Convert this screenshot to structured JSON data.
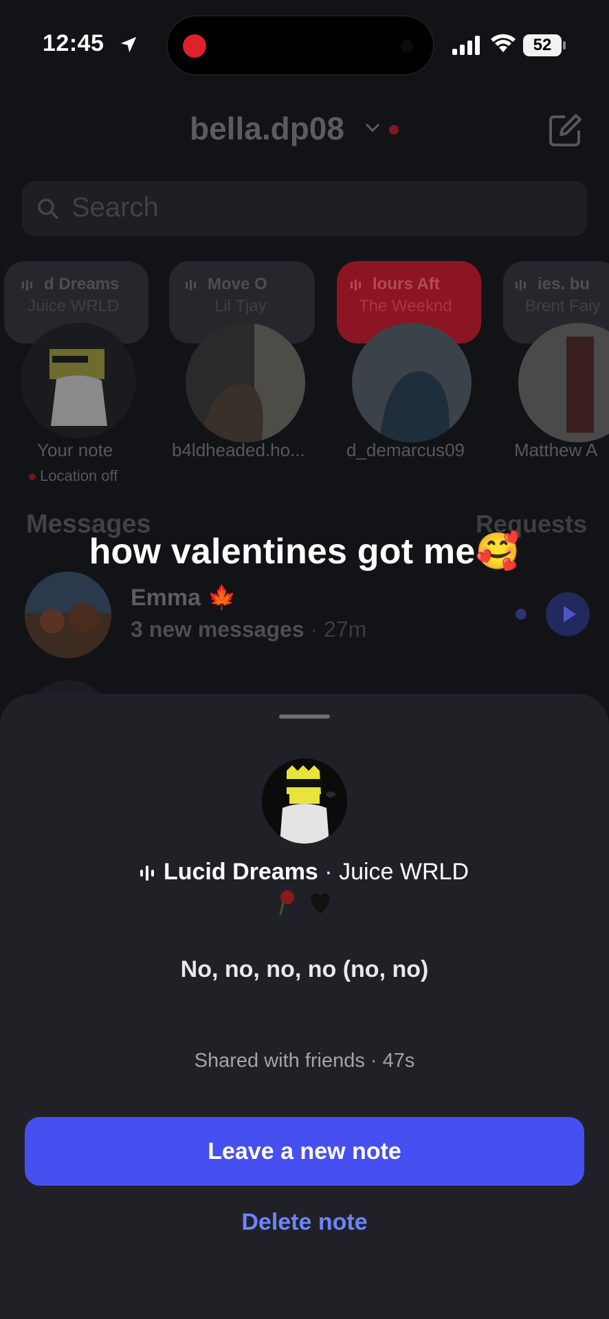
{
  "status_bar": {
    "time": "12:45",
    "battery": "52"
  },
  "header": {
    "account": "bella.dp08"
  },
  "search": {
    "placeholder": "Search"
  },
  "notes": [
    {
      "line1": "d Dreams",
      "line2": "Juice WRLD",
      "name": "Your note",
      "sub": "Location off"
    },
    {
      "line1": "Move O",
      "line2": "Lil Tjay",
      "name": "b4ldheaded.ho..."
    },
    {
      "line1": "lours   Aft",
      "line2": "The Weeknd",
      "name": "d_demarcus09"
    },
    {
      "line1": "ies.   bu",
      "line2": "Brent Faiy",
      "name": "Matthew A"
    }
  ],
  "messages": {
    "title": "Messages",
    "requests": "Requests",
    "items": [
      {
        "name": "Emma",
        "preview": "3 new messages",
        "time": "· 27m"
      }
    ]
  },
  "overlay_caption": "how valentines got me🥰",
  "sheet": {
    "song_title": "Lucid Dreams",
    "artist": "· Juice WRLD",
    "lyric": "No, no, no, no (no, no)",
    "shared": "Shared with friends · 47s",
    "primary_button": "Leave a new note",
    "delete_button": "Delete note"
  },
  "colors": {
    "accent": "#4650f0",
    "link": "#6d84ff",
    "sheet_bg": "#202126"
  },
  "icons": [
    "location-arrow-icon",
    "signal-icon",
    "wifi-icon",
    "battery-icon",
    "chevron-down-icon",
    "compose-icon",
    "search-icon",
    "audio-bars-icon",
    "play-icon"
  ]
}
